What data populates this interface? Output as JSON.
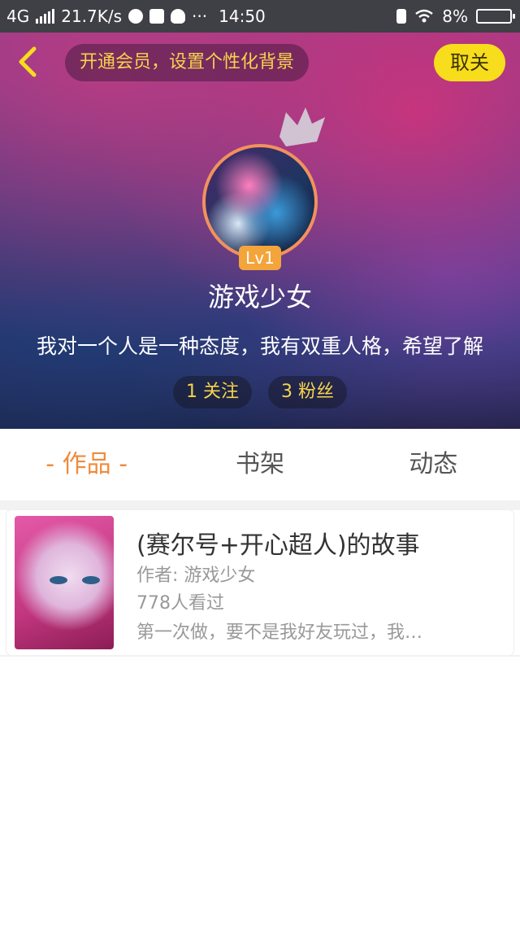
{
  "status_bar": {
    "network": "4G",
    "speed": "21.7K/s",
    "time": "14:50",
    "battery": "8%",
    "dots": "···"
  },
  "header": {
    "vip_banner": "开通会员，设置个性化背景",
    "follow_button": "取关",
    "level": "Lv1",
    "username": "游戏少女",
    "bio": "我对一个人是一种态度，我有双重人格，希望了解",
    "following": "1 关注",
    "followers": "3 粉丝"
  },
  "tabs": [
    "- 作品 -",
    "书架",
    "动态"
  ],
  "works": [
    {
      "title": "(赛尔号+开心超人)的故事",
      "author": "作者: 游戏少女",
      "views": "778人看过",
      "desc": "第一次做，要不是我好友玩过，我…"
    }
  ],
  "colors": {
    "accent": "#f08a3a",
    "yellow": "#f7dd1c",
    "vip_text": "#f6d44a"
  }
}
